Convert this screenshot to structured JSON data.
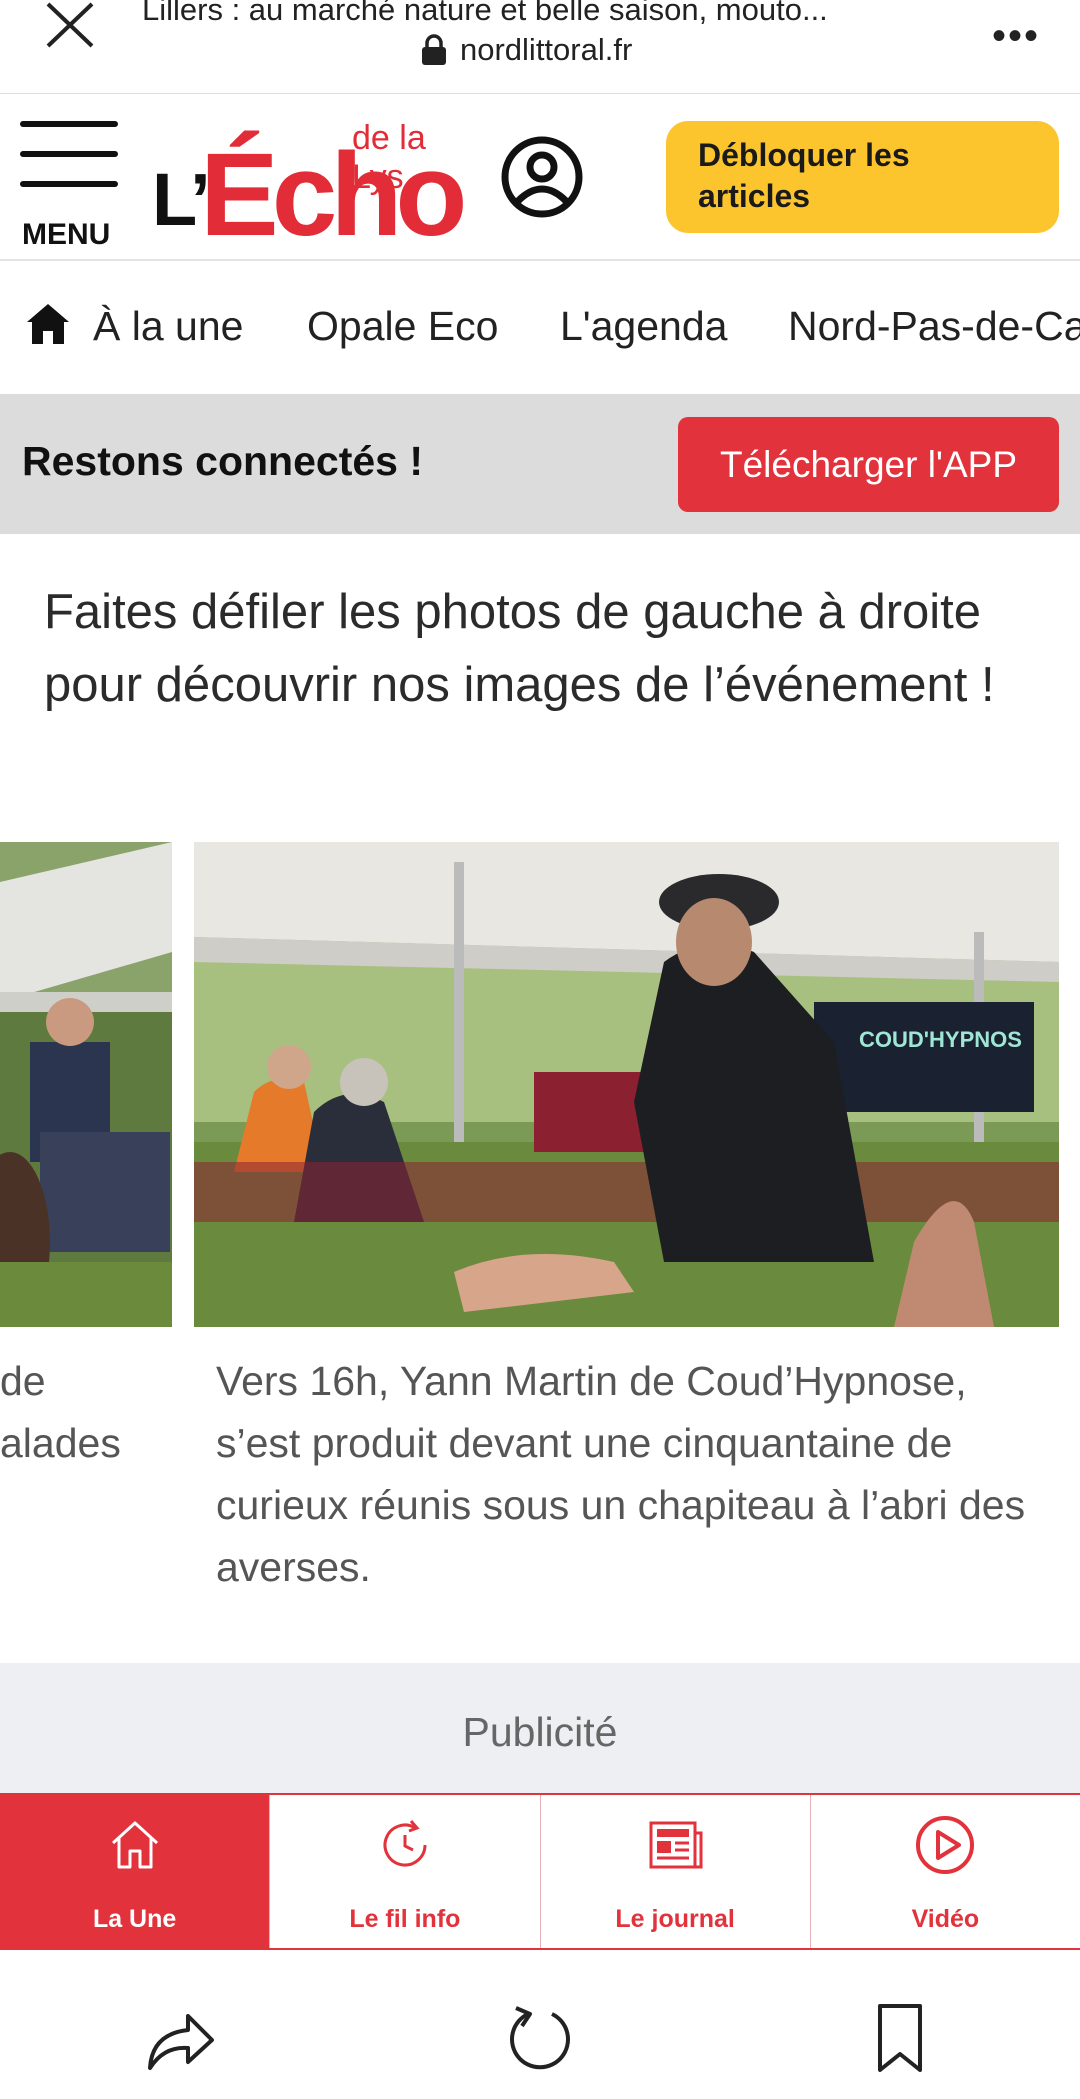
{
  "browser": {
    "title": "Lillers : au marché nature et belle saison, mouto...",
    "url": "nordlittoral.fr",
    "more_label": "•••"
  },
  "header": {
    "menu_label": "MENU",
    "logo_l": "L’",
    "logo_echo": "Écho",
    "logo_sub": "de la Lys",
    "unlock_label": "Débloquer les articles"
  },
  "nav": {
    "items": [
      "À la une",
      "Opale Eco",
      "L'agenda",
      "Nord-Pas-de-Ca"
    ]
  },
  "banner": {
    "text": "Restons connectés !",
    "button": "Télécharger l'APP"
  },
  "article": {
    "intro": "Faites défiler les photos de gauche à droite pour découvrir nos images de l’événement !",
    "caption_left_lines": [
      "de",
      "alades"
    ],
    "caption_main": "Vers 16h, Yann Martin de Coud’Hypnose, s’est produit devant une cinquantaine de curieux réunis sous un chapiteau à l’abri des averses.",
    "photo_sign": "COUD'HYPNOS"
  },
  "ad": {
    "label": "Publicité"
  },
  "tabs": [
    {
      "label": "La Une",
      "icon": "home-outline-icon",
      "active": true
    },
    {
      "label": "Le fil info",
      "icon": "clock-refresh-icon",
      "active": false
    },
    {
      "label": "Le journal",
      "icon": "newspaper-icon",
      "active": false
    },
    {
      "label": "Vidéo",
      "icon": "play-circle-icon",
      "active": false
    }
  ],
  "colors": {
    "brand_red": "#e2323c",
    "unlock_yellow": "#fcc52e",
    "banner_grey": "#dcdcdc"
  }
}
